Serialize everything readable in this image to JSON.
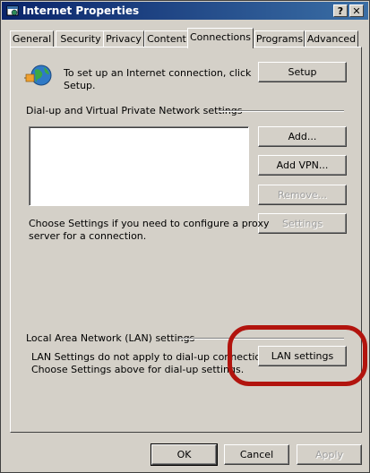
{
  "window": {
    "title": "Internet Properties",
    "help_label": "?",
    "close_label": "✕"
  },
  "tabs": [
    {
      "label": "General"
    },
    {
      "label": "Security"
    },
    {
      "label": "Privacy"
    },
    {
      "label": "Content"
    },
    {
      "label": "Connections"
    },
    {
      "label": "Programs"
    },
    {
      "label": "Advanced"
    }
  ],
  "active_tab": "Connections",
  "setup_section": {
    "text_line1": "To set up an Internet connection, click",
    "text_line2": "Setup.",
    "setup_button": "Setup"
  },
  "vpn_section": {
    "heading": "Dial-up and Virtual Private Network settings",
    "add_button": "Add...",
    "add_vpn_button": "Add VPN...",
    "remove_button": "Remove...",
    "settings_button": "Settings",
    "proxy_text_line1": "Choose Settings if you need to configure a proxy",
    "proxy_text_line2": "server for a connection."
  },
  "lan_section": {
    "heading": "Local Area Network (LAN) settings",
    "text_line1": "LAN Settings do not apply to dial-up connections.",
    "text_line2": "Choose Settings above for dial-up settings.",
    "lan_button": "LAN settings"
  },
  "footer": {
    "ok_button": "OK",
    "cancel_button": "Cancel",
    "apply_button": "Apply"
  },
  "colors": {
    "highlight_ring": "#b2140e",
    "titlebar": "#0a246a"
  }
}
